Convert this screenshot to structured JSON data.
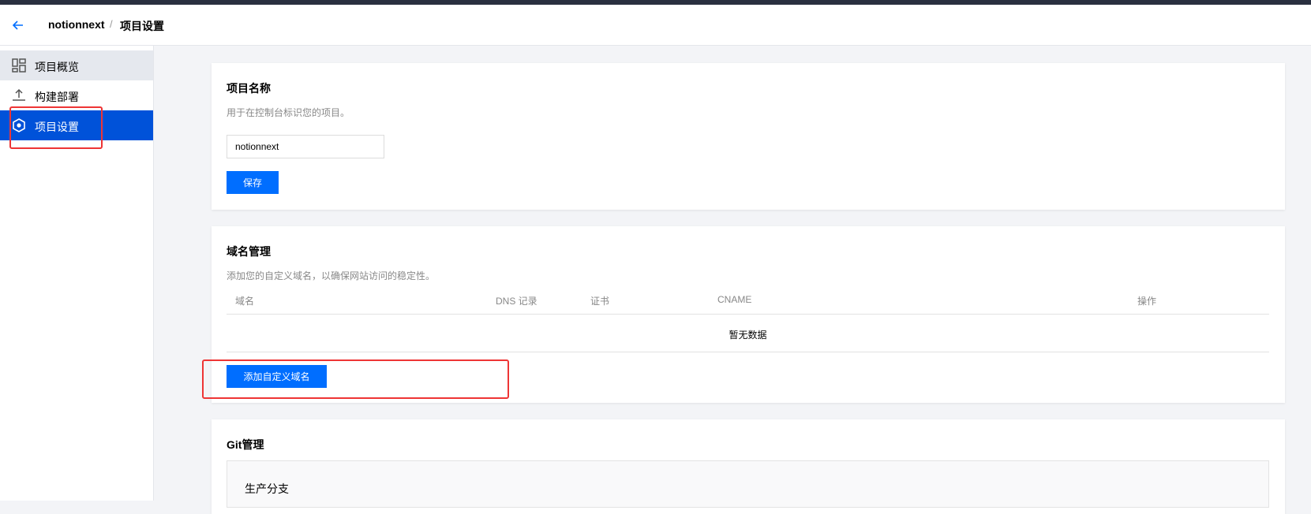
{
  "header": {
    "back_icon": "arrow-left-icon",
    "project_name": "notionnext",
    "separator": "/",
    "page_title": "项目设置"
  },
  "colors": {
    "accent": "#006eff",
    "nav_active": "#0052d9",
    "highlight": "#ee3535",
    "top_strip": "#2a3040"
  },
  "sidebar": {
    "items": [
      {
        "label": "项目概览",
        "icon": "dashboard-icon",
        "state": "hover"
      },
      {
        "label": "构建部署",
        "icon": "upload-icon",
        "state": "normal"
      },
      {
        "label": "项目设置",
        "icon": "settings-icon",
        "state": "active"
      }
    ]
  },
  "project_name_card": {
    "title": "项目名称",
    "description": "用于在控制台标识您的项目。",
    "input_value": "notionnext",
    "save_label": "保存"
  },
  "domain_card": {
    "title": "域名管理",
    "description": "添加您的自定义域名，以确保网站访问的稳定性。",
    "columns": [
      "域名",
      "DNS 记录",
      "证书",
      "CNAME",
      "操作"
    ],
    "empty_text": "暂无数据",
    "add_button_label": "添加自定义域名"
  },
  "git_card": {
    "title": "Git管理",
    "branch_label": "生产分支"
  }
}
